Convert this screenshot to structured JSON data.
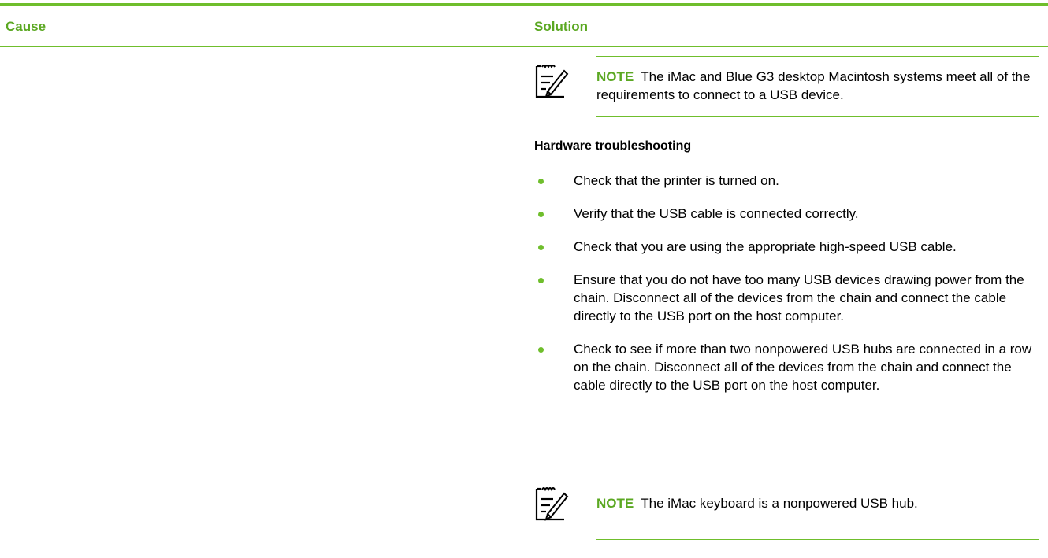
{
  "table": {
    "header_cause": "Cause",
    "header_solution": "Solution"
  },
  "note1": {
    "label": "NOTE",
    "text": "The iMac and Blue G3 desktop Macintosh systems meet all of the requirements to connect to a USB device."
  },
  "hardware": {
    "heading": "Hardware troubleshooting",
    "items": [
      "Check that the printer is turned on.",
      "Verify that the USB cable is connected correctly.",
      "Check that you are using the appropriate high-speed USB cable.",
      "Ensure that you do not have too many USB devices drawing power from the chain. Disconnect all of the devices from the chain and connect the cable directly to the USB port on the host computer.",
      "Check to see if more than two nonpowered USB hubs are connected in a row on the chain. Disconnect all of the devices from the chain and connect the cable directly to the USB port on the host computer."
    ]
  },
  "note2": {
    "label": "NOTE",
    "text": "The iMac keyboard is a nonpowered USB hub."
  },
  "colors": {
    "accent": "#6fbe2c",
    "heading_green": "#5ba822"
  }
}
